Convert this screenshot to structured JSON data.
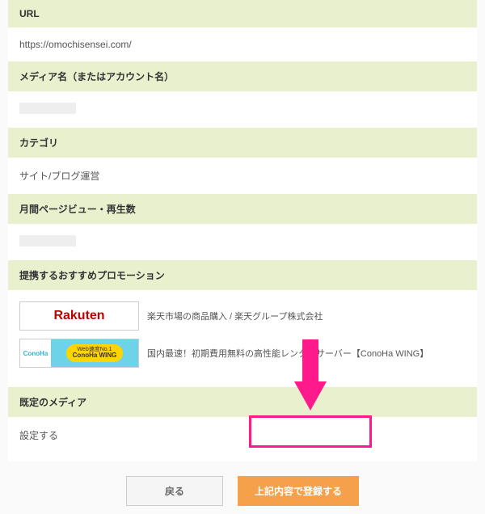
{
  "sections": {
    "url": {
      "label": "URL",
      "value": "https://omochisensei.com/"
    },
    "mediaName": {
      "label": "メディア名（またはアカウント名）"
    },
    "category": {
      "label": "カテゴリ",
      "value": "サイト/ブログ運営"
    },
    "pageviews": {
      "label": "月間ページビュー・再生数"
    },
    "promotions": {
      "label": "提携するおすすめプロモーション"
    },
    "defaultMedia": {
      "label": "既定のメディア",
      "value": "設定する"
    }
  },
  "promos": {
    "rakuten": {
      "logo": "Rakuten",
      "desc": "楽天市場の商品購入 / 楽天グループ株式会社"
    },
    "conoha": {
      "logoLeft": "ConoHa",
      "badge1": "Web速度No.1",
      "badge2": "ConoHa WING",
      "desc": "国内最速！初期費用無料の高性能レンタルサーバー【ConoHa WING】"
    }
  },
  "buttons": {
    "back": "戻る",
    "submit": "上記内容で登録する"
  }
}
